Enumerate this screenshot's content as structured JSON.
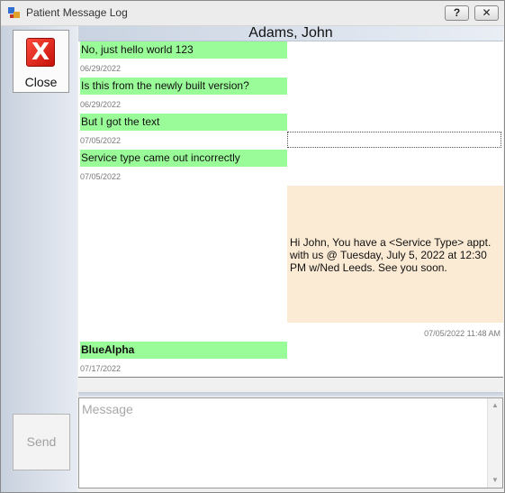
{
  "window": {
    "title": "Patient Message Log",
    "help_button": "?",
    "close_button": "✕"
  },
  "toolbar": {
    "close_label": "Close",
    "close_icon_glyph": "X",
    "send_label": "Send"
  },
  "header": {
    "patient_name": "Adams, John"
  },
  "messages": [
    {
      "direction": "out",
      "text": "No, just hello world 123",
      "date": "06/29/2022"
    },
    {
      "direction": "out",
      "text": "Is this from the newly built version?",
      "date": "06/29/2022"
    },
    {
      "direction": "out",
      "text": "But I got the text",
      "date": "07/05/2022"
    },
    {
      "direction": "out",
      "text": "Service type came out incorrectly",
      "date": "07/05/2022"
    },
    {
      "direction": "in",
      "text": "Hi John, You have a <Service Type> appt. with us @ Tuesday, July 5, 2022 at 12:30 PM w/Ned Leeds. See you soon.",
      "date": "07/05/2022 11:48 AM"
    },
    {
      "direction": "out",
      "text": "BlueAlpha",
      "date": "07/17/2022"
    }
  ],
  "compose": {
    "placeholder": "Message",
    "value": ""
  },
  "colors": {
    "outgoing_bubble": "#9afc98",
    "incoming_bubble": "#fcebd4",
    "close_icon": "#e0261b"
  },
  "icons": {
    "app": "app-window-icon",
    "close": "close-x-icon"
  }
}
